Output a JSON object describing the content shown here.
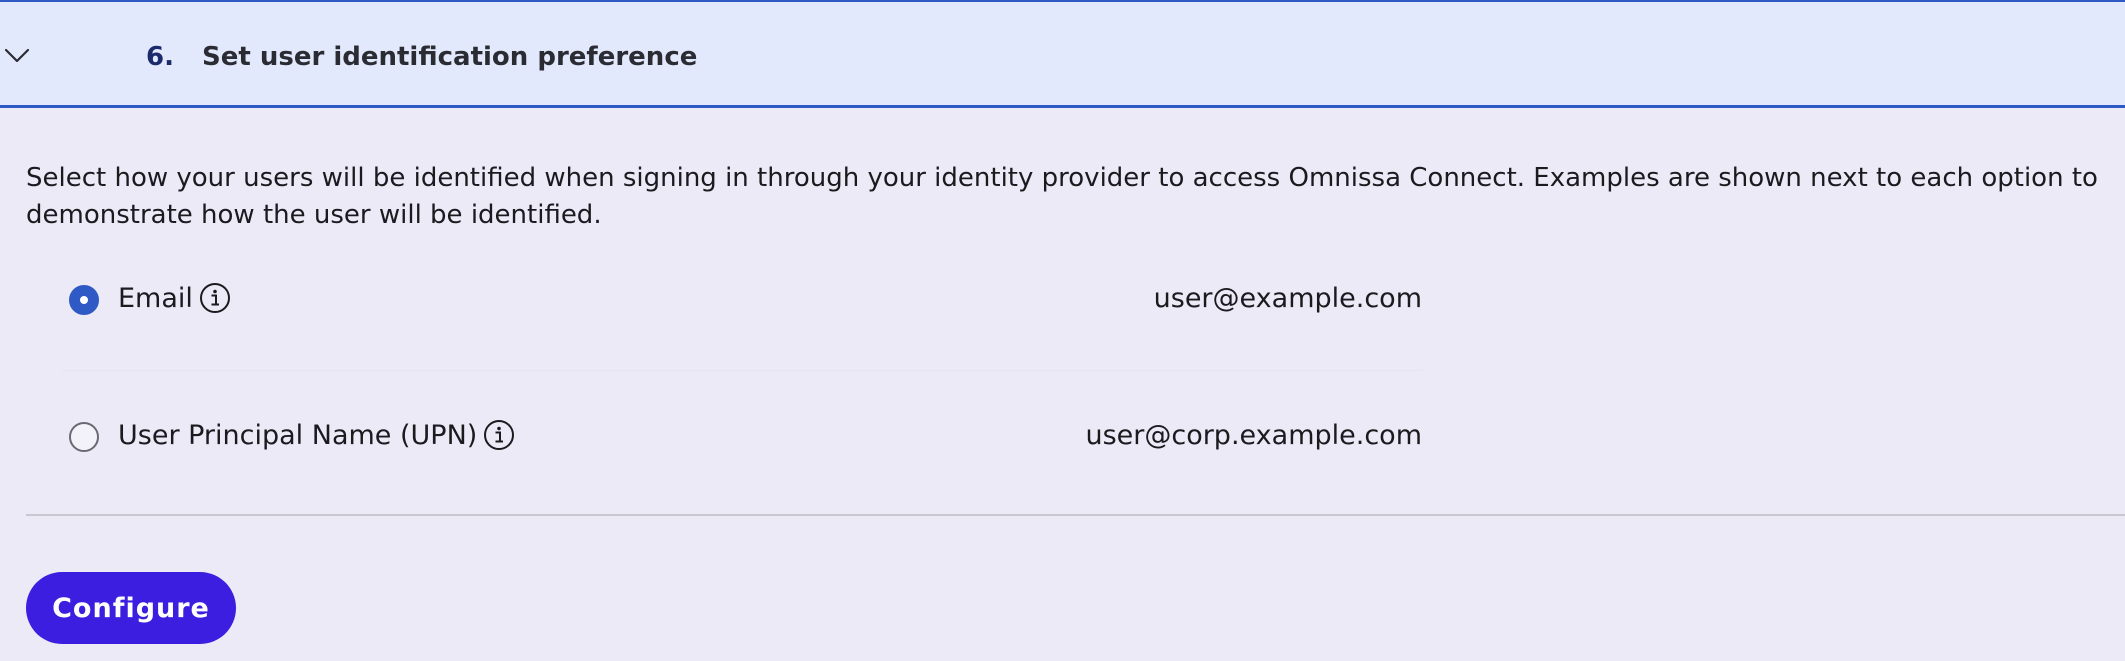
{
  "step": {
    "number": "6.",
    "title": "Set user identification preference",
    "expand_icon": "chevron-down-icon"
  },
  "description": "Select how your users will be identified when signing in through your identity provider to access Omnissa Connect. Examples are shown next to each option to demonstrate how the user will be identified.",
  "options": [
    {
      "label": "Email",
      "example": "user@example.com",
      "selected": true,
      "info_icon": "info-icon"
    },
    {
      "label": "User Principal Name (UPN)",
      "example": "user@corp.example.com",
      "selected": false,
      "info_icon": "info-icon"
    }
  ],
  "actions": {
    "configure_label": "Configure"
  },
  "colors": {
    "accent_blue": "#2f59c4",
    "header_bg": "#e3e9fc",
    "page_bg": "#eceaf6",
    "button_bg": "#3b1ee0"
  }
}
